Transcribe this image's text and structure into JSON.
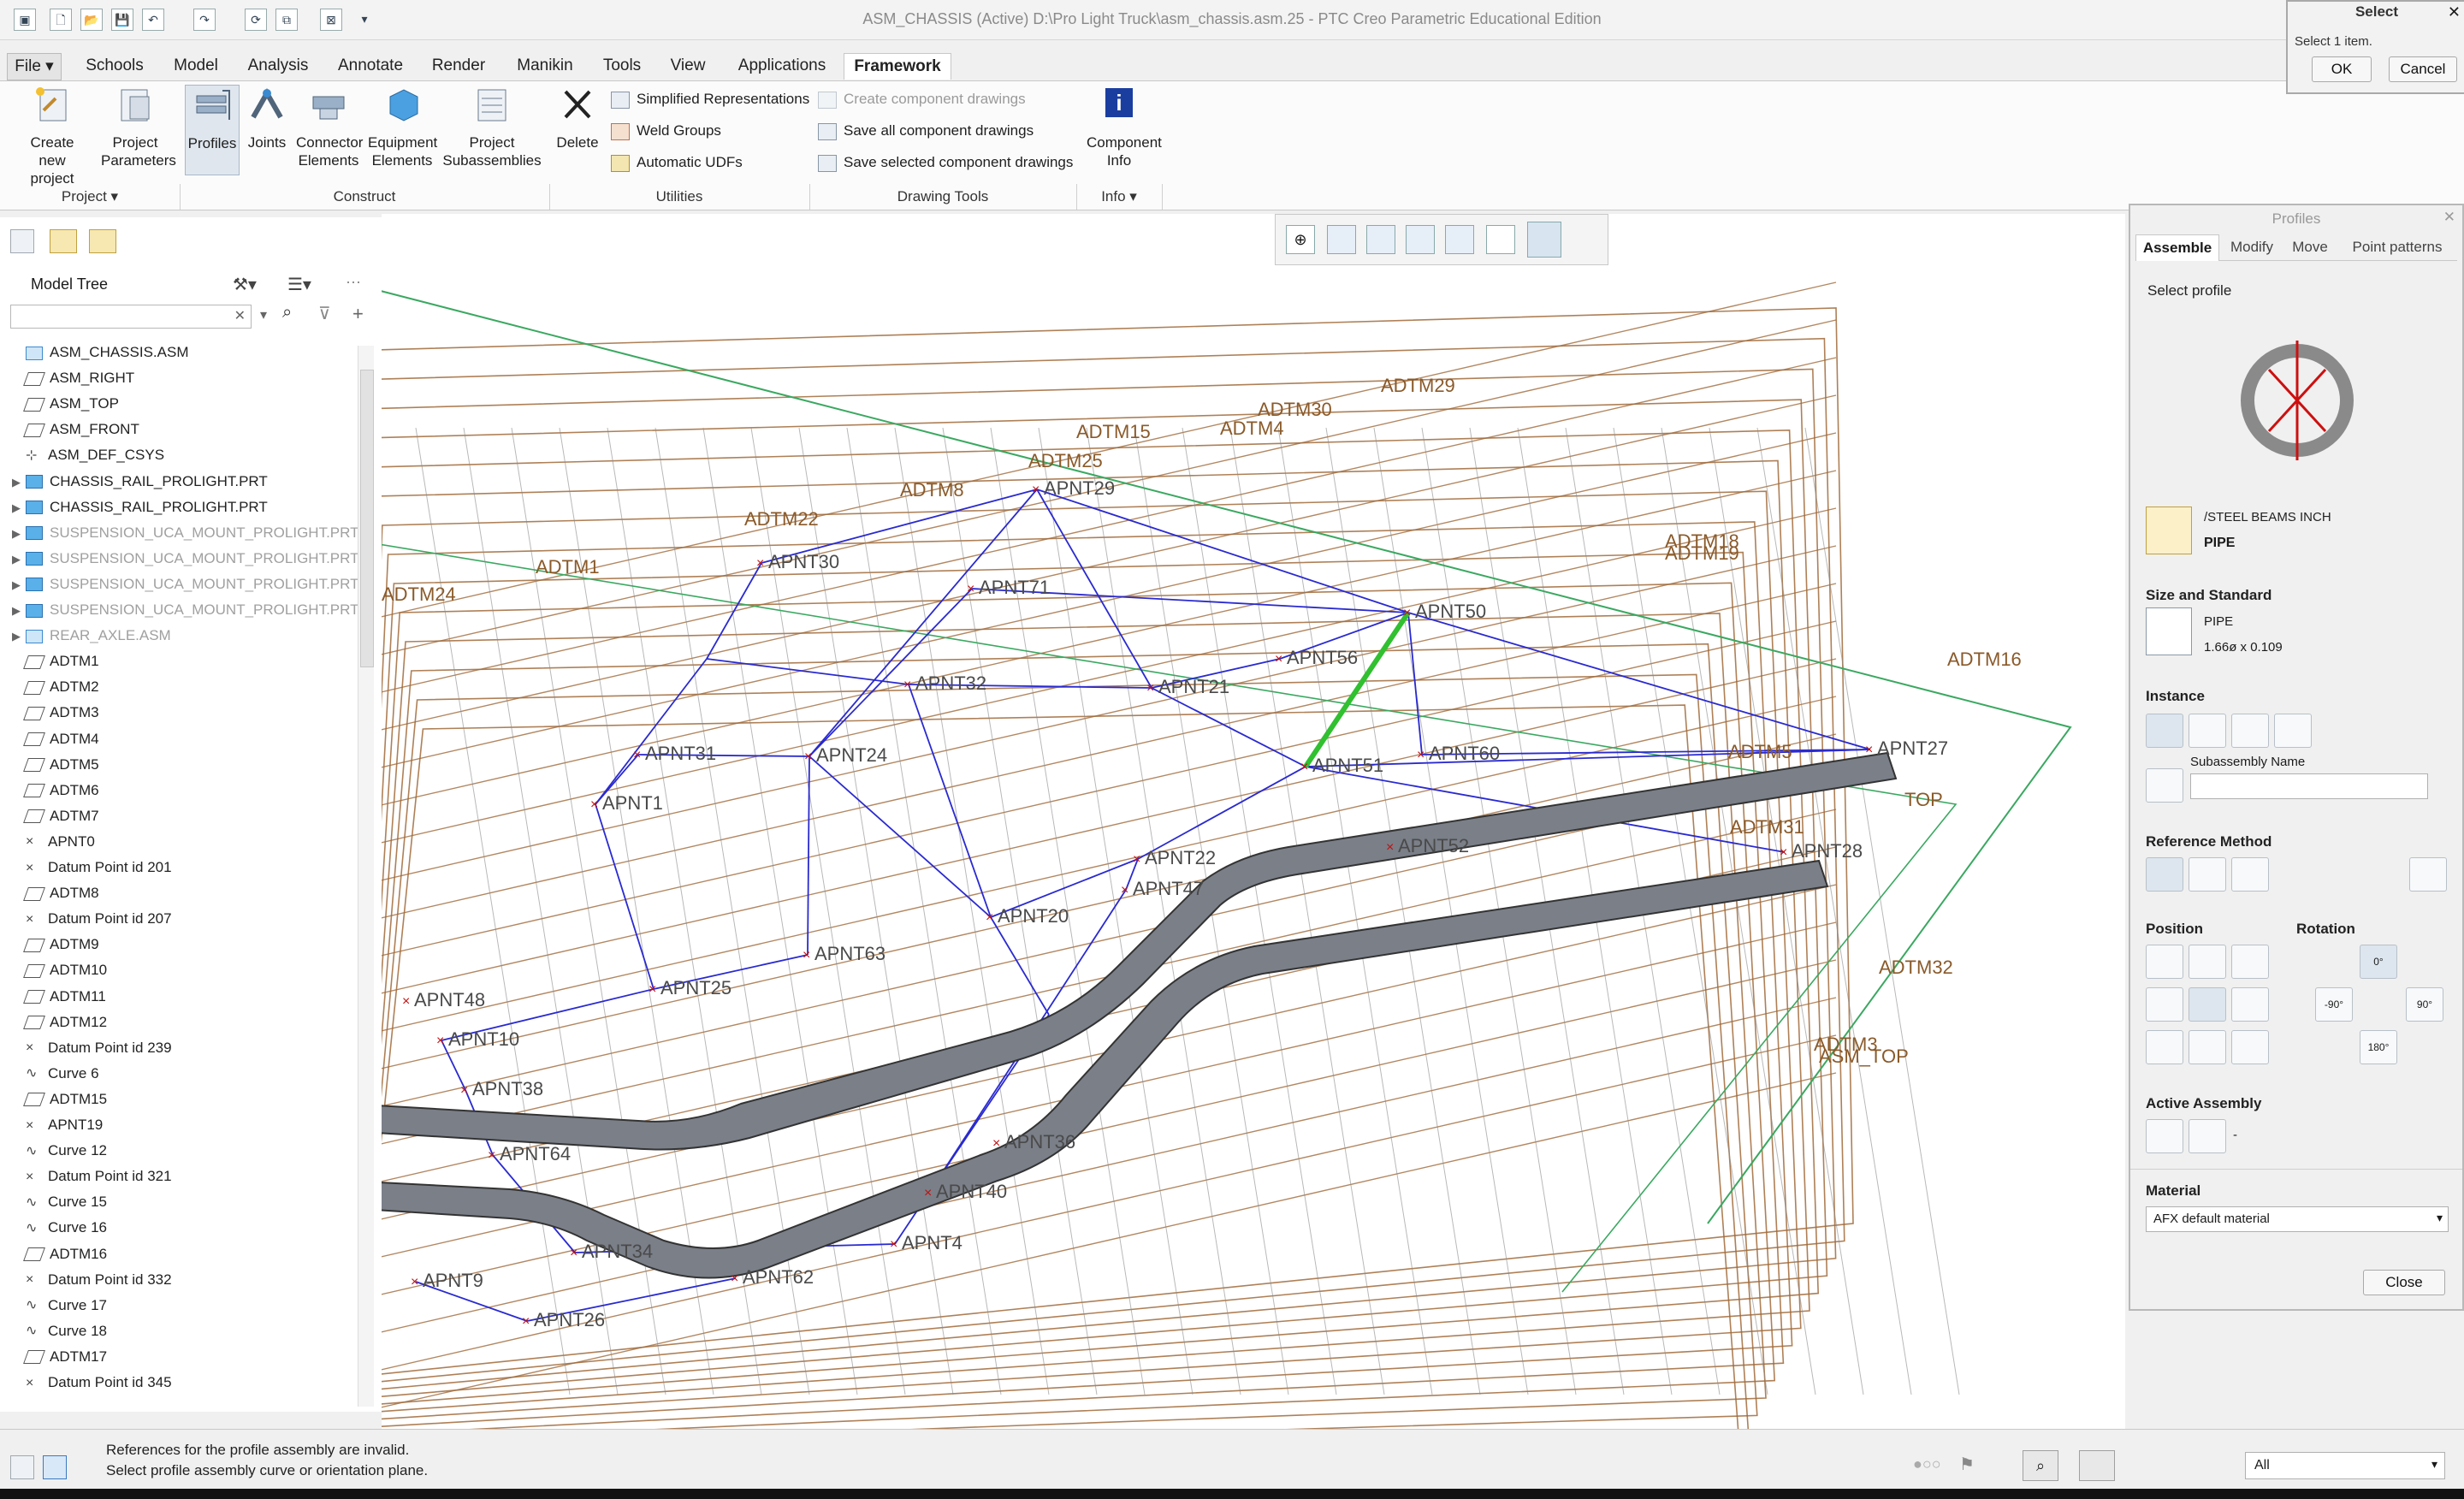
{
  "window": {
    "title": "ASM_CHASSIS (Active) D:\\Pro Light Truck\\asm_chassis.asm.25 - PTC Creo Parametric Educational Edition"
  },
  "tabs": [
    "File",
    "Schools",
    "Model",
    "Analysis",
    "Annotate",
    "Render",
    "Manikin",
    "Tools",
    "View",
    "Applications",
    "Framework"
  ],
  "active_tab": "Framework",
  "ribbon": {
    "create_new_project": "Create new project",
    "project_parameters": "Project Parameters",
    "profiles": "Profiles",
    "joints": "Joints",
    "connector_elements": "Connector Elements",
    "equipment_elements": "Equipment Elements",
    "project_subassemblies": "Project Subassemblies",
    "delete": "Delete",
    "simplified_representations": "Simplified Representations",
    "weld_groups": "Weld Groups",
    "automatic_udfs": "Automatic UDFs",
    "create_component_drawings": "Create component drawings",
    "save_all_component_drawings": "Save all component drawings",
    "save_selected_component_drawings": "Save selected component drawings",
    "component_info": "Component Info",
    "groups": {
      "project": "Project ▾",
      "construct": "Construct",
      "utilities": "Utilities",
      "drawing_tools": "Drawing Tools",
      "info": "Info ▾"
    }
  },
  "model_tree": {
    "title": "Model Tree",
    "search_value": "",
    "items": [
      {
        "label": "ASM_CHASSIS.ASM",
        "icon": "assembly-icon",
        "dim": false,
        "expandable": false
      },
      {
        "label": "ASM_RIGHT",
        "icon": "datum-plane-icon",
        "dim": false,
        "expandable": false
      },
      {
        "label": "ASM_TOP",
        "icon": "datum-plane-icon",
        "dim": false,
        "expandable": false
      },
      {
        "label": "ASM_FRONT",
        "icon": "datum-plane-icon",
        "dim": false,
        "expandable": false
      },
      {
        "label": "ASM_DEF_CSYS",
        "icon": "csys-icon",
        "dim": false,
        "expandable": false
      },
      {
        "label": "CHASSIS_RAIL_PROLIGHT.PRT",
        "icon": "part-icon",
        "dim": false,
        "expandable": true
      },
      {
        "label": "CHASSIS_RAIL_PROLIGHT.PRT",
        "icon": "part-icon",
        "dim": false,
        "expandable": true
      },
      {
        "label": "SUSPENSION_UCA_MOUNT_PROLIGHT.PRT",
        "icon": "part-icon",
        "dim": true,
        "expandable": true
      },
      {
        "label": "SUSPENSION_UCA_MOUNT_PROLIGHT.PRT",
        "icon": "part-icon",
        "dim": true,
        "expandable": true
      },
      {
        "label": "SUSPENSION_UCA_MOUNT_PROLIGHT.PRT",
        "icon": "part-icon",
        "dim": true,
        "expandable": true
      },
      {
        "label": "SUSPENSION_UCA_MOUNT_PROLIGHT.PRT",
        "icon": "part-icon",
        "dim": true,
        "expandable": true
      },
      {
        "label": "REAR_AXLE.ASM",
        "icon": "assembly-icon",
        "dim": true,
        "expandable": true
      },
      {
        "label": "ADTM1",
        "icon": "datum-plane-icon",
        "dim": false,
        "expandable": false
      },
      {
        "label": "ADTM2",
        "icon": "datum-plane-icon",
        "dim": false,
        "expandable": false
      },
      {
        "label": "ADTM3",
        "icon": "datum-plane-icon",
        "dim": false,
        "expandable": false
      },
      {
        "label": "ADTM4",
        "icon": "datum-plane-icon",
        "dim": false,
        "expandable": false
      },
      {
        "label": "ADTM5",
        "icon": "datum-plane-icon",
        "dim": false,
        "expandable": false
      },
      {
        "label": "ADTM6",
        "icon": "datum-plane-icon",
        "dim": false,
        "expandable": false
      },
      {
        "label": "ADTM7",
        "icon": "datum-plane-icon",
        "dim": false,
        "expandable": false
      },
      {
        "label": "APNT0",
        "icon": "datum-point-icon",
        "dim": false,
        "expandable": false
      },
      {
        "label": "Datum Point id 201",
        "icon": "datum-point-icon",
        "dim": false,
        "expandable": false
      },
      {
        "label": "ADTM8",
        "icon": "datum-plane-icon",
        "dim": false,
        "expandable": false
      },
      {
        "label": "Datum Point id 207",
        "icon": "datum-point-icon",
        "dim": false,
        "expandable": false
      },
      {
        "label": "ADTM9",
        "icon": "datum-plane-icon",
        "dim": false,
        "expandable": false
      },
      {
        "label": "ADTM10",
        "icon": "datum-plane-icon",
        "dim": false,
        "expandable": false
      },
      {
        "label": "ADTM11",
        "icon": "datum-plane-icon",
        "dim": false,
        "expandable": false
      },
      {
        "label": "ADTM12",
        "icon": "datum-plane-icon",
        "dim": false,
        "expandable": false
      },
      {
        "label": "Datum Point id 239",
        "icon": "datum-point-icon",
        "dim": false,
        "expandable": false
      },
      {
        "label": "Curve 6",
        "icon": "curve-icon",
        "dim": false,
        "expandable": false
      },
      {
        "label": "ADTM15",
        "icon": "datum-plane-icon",
        "dim": false,
        "expandable": false
      },
      {
        "label": "APNT19",
        "icon": "datum-point-icon",
        "dim": false,
        "expandable": false
      },
      {
        "label": "Curve 12",
        "icon": "curve-icon",
        "dim": false,
        "expandable": false
      },
      {
        "label": "Datum Point id 321",
        "icon": "datum-point-icon",
        "dim": false,
        "expandable": false
      },
      {
        "label": "Curve 15",
        "icon": "curve-icon",
        "dim": false,
        "expandable": false
      },
      {
        "label": "Curve 16",
        "icon": "curve-icon",
        "dim": false,
        "expandable": false
      },
      {
        "label": "ADTM16",
        "icon": "datum-plane-icon",
        "dim": false,
        "expandable": false
      },
      {
        "label": "Datum Point id 332",
        "icon": "datum-point-icon",
        "dim": false,
        "expandable": false
      },
      {
        "label": "Curve 17",
        "icon": "curve-icon",
        "dim": false,
        "expandable": false
      },
      {
        "label": "Curve 18",
        "icon": "curve-icon",
        "dim": false,
        "expandable": false
      },
      {
        "label": "ADTM17",
        "icon": "datum-plane-icon",
        "dim": false,
        "expandable": false
      },
      {
        "label": "Datum Point id 345",
        "icon": "datum-point-icon",
        "dim": false,
        "expandable": false
      }
    ]
  },
  "graphics": {
    "plane_labels": [
      "ADTM1",
      "ADTM24",
      "ADTM22",
      "ADTM8",
      "ADTM25",
      "ADTM15",
      "ADTM4",
      "ADTM30",
      "ADTM29",
      "ADTM18",
      "ADTM19",
      "ADTM16",
      "ADTM5",
      "ADTM31",
      "ADTM32",
      "ADTM3",
      "ASM_TOP",
      "TOP"
    ],
    "point_labels": [
      "APNT29",
      "APNT30",
      "APNT71",
      "APNT50",
      "APNT56",
      "APNT27",
      "APNT52",
      "APNT32",
      "APNT21",
      "APNT31",
      "APNT24",
      "APNT1",
      "APNT60",
      "APNT51",
      "APNT22",
      "APNT47",
      "APNT20",
      "APNT63",
      "APNT25",
      "APNT10",
      "APNT38",
      "APNT64",
      "APNT34",
      "APNT40",
      "APNT4",
      "APNT62",
      "APNT26",
      "APNT28",
      "APNT9",
      "APNT36",
      "APNT48"
    ],
    "colors": {
      "plane": "#a06a3a",
      "wire": "#2a2ad0",
      "highlight": "#30c030",
      "rail": "#7a7f88",
      "asm_plane": "#3aa860"
    }
  },
  "profiles_panel": {
    "title": "Profiles",
    "tabs": [
      "Assemble",
      "Modify",
      "Move",
      "Point patterns"
    ],
    "active_tab": "Assemble",
    "select_profile": "Select profile",
    "library": "/STEEL BEAMS INCH",
    "profile_name": "PIPE",
    "size_and_standard": "Size and Standard",
    "size_name": "PIPE",
    "size_value": "1.66ø x 0.109",
    "instance": "Instance",
    "subassembly_name": "Subassembly Name",
    "subassembly_value": "",
    "reference_method": "Reference Method",
    "position": "Position",
    "rotation": "Rotation",
    "rot_0": "0°",
    "rot_neg90": "-90°",
    "rot_90": "90°",
    "rot_180": "180°",
    "active_assembly": "Active Assembly",
    "active_assembly_value": "-",
    "material": "Material",
    "material_value": "AFX default material",
    "close": "Close"
  },
  "select_dialog": {
    "title": "Select",
    "prompt": "Select 1 item.",
    "ok": "OK",
    "cancel": "Cancel"
  },
  "status": {
    "line1": "References for the profile assembly are invalid.",
    "line2": "Select profile assembly curve or orientation plane.",
    "filter": "All"
  }
}
